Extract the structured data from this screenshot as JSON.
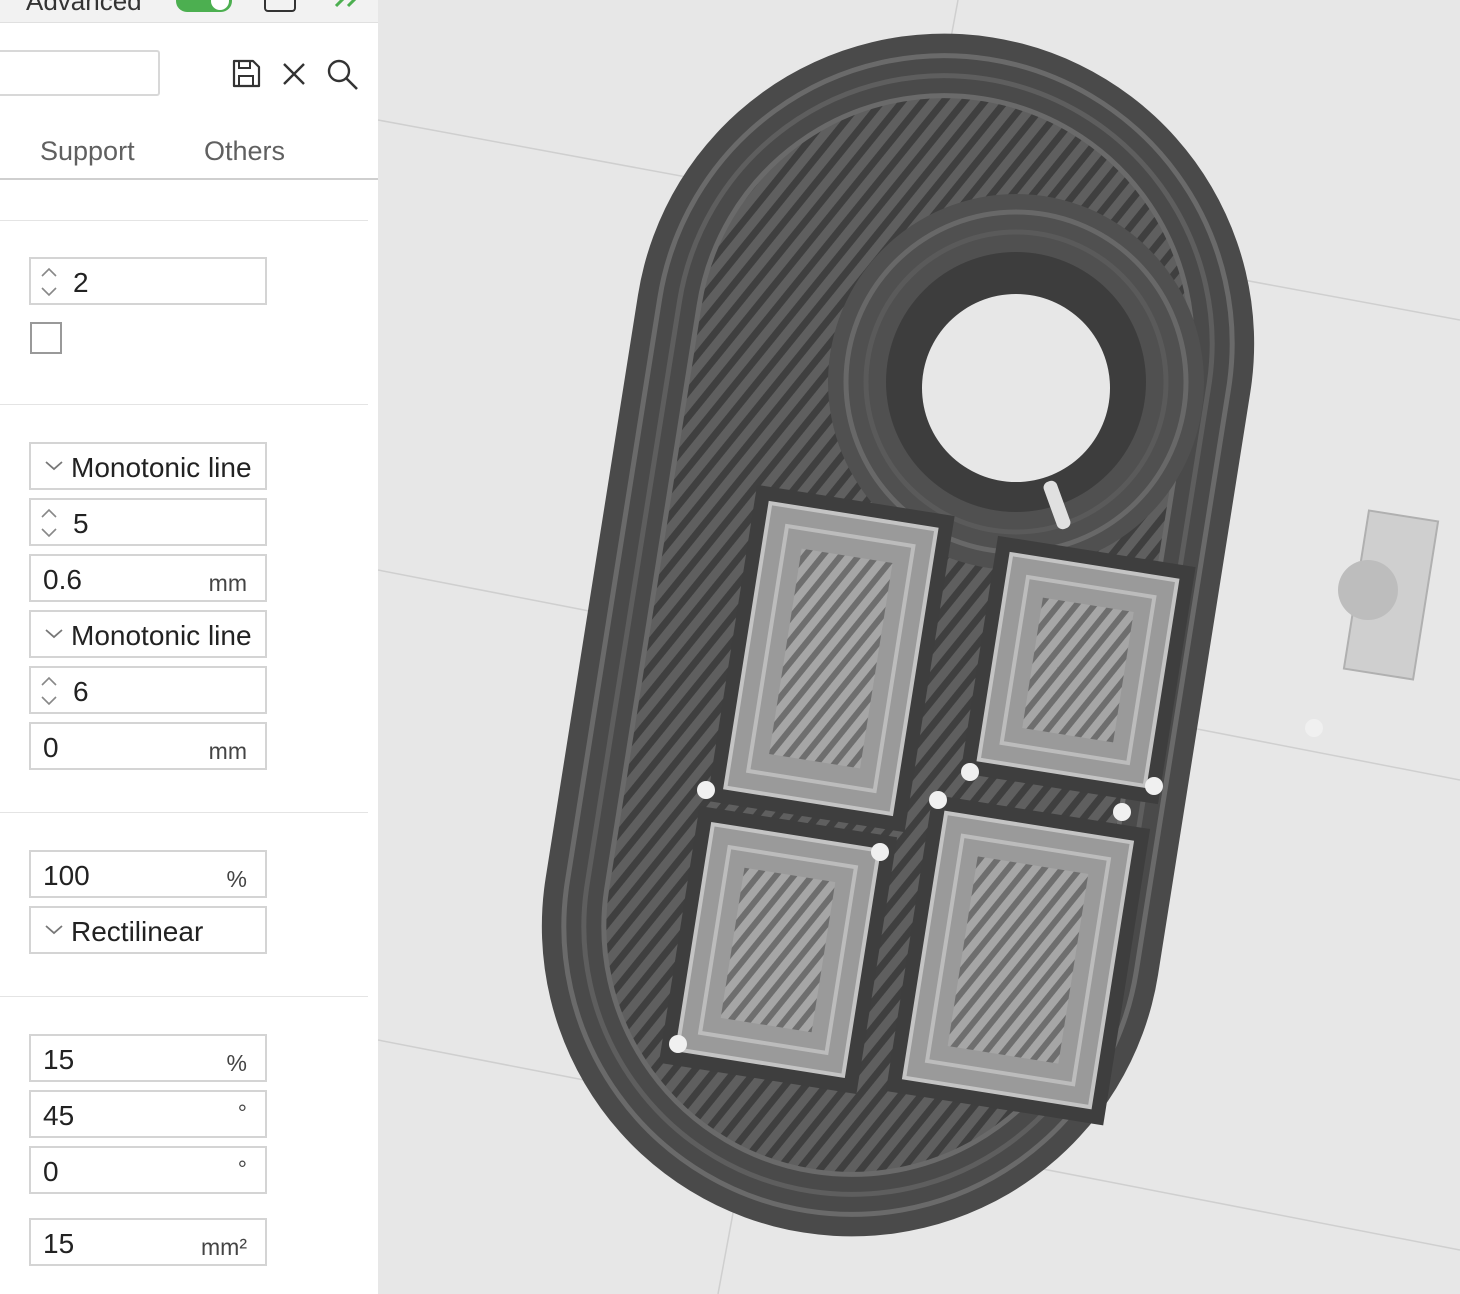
{
  "topbar": {
    "mode_label": "Advanced"
  },
  "tabs": [
    {
      "label": "Support"
    },
    {
      "label": "Others"
    }
  ],
  "fields": {
    "f1": {
      "value": "2"
    },
    "f2": {
      "value": "Monotonic line"
    },
    "f3": {
      "value": "5"
    },
    "f4": {
      "value": "0.6",
      "unit": "mm"
    },
    "f5": {
      "value": "Monotonic line"
    },
    "f6": {
      "value": "6"
    },
    "f7": {
      "value": "0",
      "unit": "mm"
    },
    "f8": {
      "value": "100",
      "unit": "%"
    },
    "f9": {
      "value": "Rectilinear"
    },
    "f10": {
      "value": "15",
      "unit": "%"
    },
    "f11": {
      "value": "45",
      "unit": "°"
    },
    "f12": {
      "value": "0",
      "unit": "°"
    },
    "f13": {
      "value": "15",
      "unit": "mm²"
    }
  },
  "colors": {
    "accent": "#4caf50",
    "model": "#5b5b5b",
    "model_light": "#9a9a9a"
  }
}
